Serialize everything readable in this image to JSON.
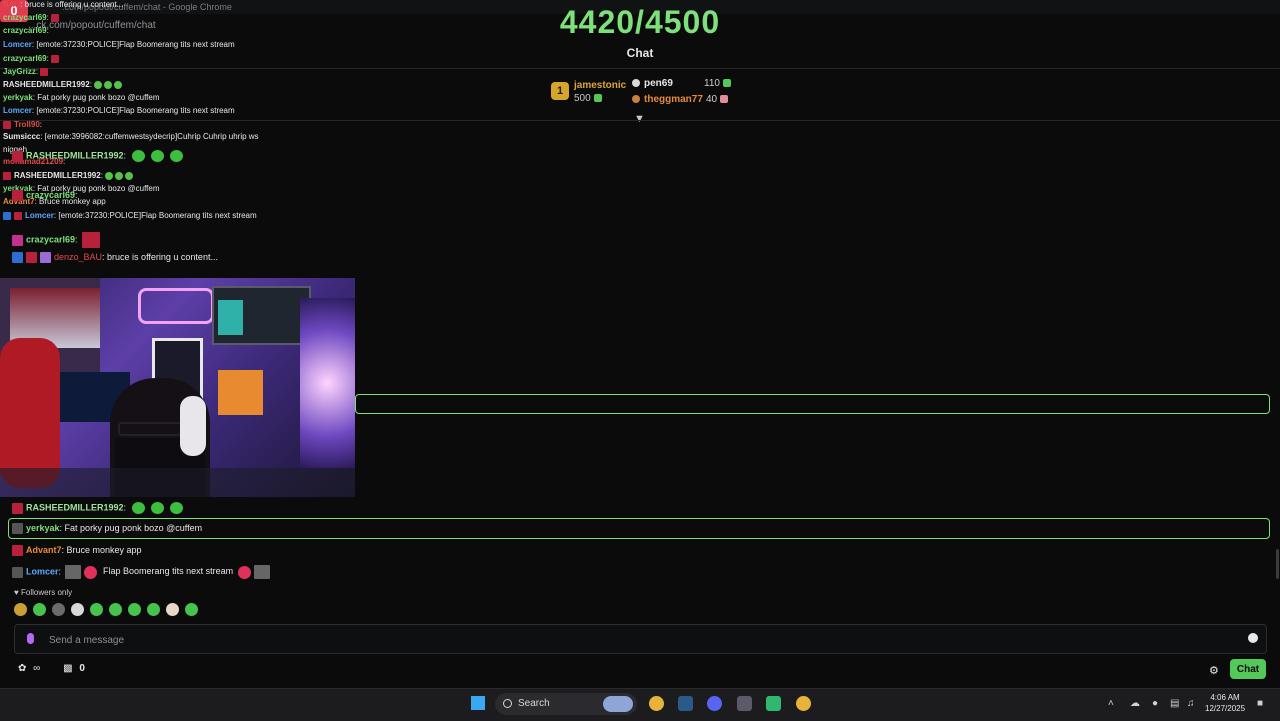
{
  "window": {
    "title": ".com/popout/cuffem/chat - Google Chrome",
    "url": "...ck.com/popout/cuffem/chat",
    "badge": "0"
  },
  "goal": {
    "text": "4420/4500"
  },
  "chat_title": "Chat",
  "leaderboard": {
    "first": {
      "rank": "1",
      "name": "jamestonic",
      "points": "500"
    },
    "second": {
      "name": "pen69",
      "points": "110"
    },
    "third": {
      "name": "theggman77",
      "points": "40"
    }
  },
  "overlay_lines": [
    {
      "user": "BAU",
      "text": ": bruce is offering u content..."
    },
    {
      "user": "crazycarl69",
      "text": ":"
    },
    {
      "user": "crazycarl69",
      "text": ":"
    },
    {
      "user": "Lomcer",
      "text": ": [emote:37230:POLICE]Flap Boomerang tits next stream"
    },
    {
      "user": "crazycarl69",
      "text": ":"
    },
    {
      "user": "JayGrizz",
      "text": ":"
    },
    {
      "user": "crazycarl69",
      "text": ":"
    },
    {
      "user": "RASHEEDMILLER1992",
      "text": ":"
    },
    {
      "user": "yerkyak",
      "text": ": Fat porky pug ponk bozo @cuffem"
    },
    {
      "user": "Lomcer",
      "text": ": [emote:37230:POLICE]Flap Boomerang tits next stream"
    },
    {
      "user": "Troll90",
      "text": ":"
    },
    {
      "user": "Sumsiccc",
      "text": ": [emote:3996082:cuffemwestsydecrip]Cuhrip Cuhrip uhrip ws"
    },
    {
      "user": "",
      "text": "niggeh"
    },
    {
      "user": "mohamad21209",
      "text": ":"
    },
    {
      "user": "RASHEEDMILLER1992",
      "text": ":"
    },
    {
      "user": "yerkyak",
      "text": ": Fat porky pug ponk bozo @cuffem"
    },
    {
      "user": "Advant7",
      "text": ": Bruce monkey app"
    },
    {
      "user": "Lomcer",
      "text": ": [emote:37230:POLICE]Flap Boomerang tits next stream"
    }
  ],
  "chat_lines": [
    {
      "user": "RASHEEDMILLER1992",
      "text": ":"
    },
    {
      "user": "crazycarl69",
      "text": ":"
    },
    {
      "user": "crazycarl69",
      "text": ":"
    },
    {
      "user": "denzo_BAU",
      "text": ": bruce is offering u content..."
    }
  ],
  "bottom_lines": [
    {
      "user": "RASHEEDMILLER1992",
      "text": ":"
    },
    {
      "user": "yerkyak",
      "text": ": Fat porky pug ponk bozo @cuffem"
    },
    {
      "user": "Advant7",
      "text": ": Bruce monkey app"
    },
    {
      "user": "Lomcer",
      "text": ":",
      "text2": "Flap Boomerang tits next stream"
    }
  ],
  "followers_only": "Followers only",
  "input": {
    "placeholder": "Send a message"
  },
  "footer": {
    "count": "0",
    "chat_button": "Chat"
  },
  "taskbar": {
    "search_label": "Search",
    "time": "4:06 AM",
    "date": "12/27/2025"
  }
}
